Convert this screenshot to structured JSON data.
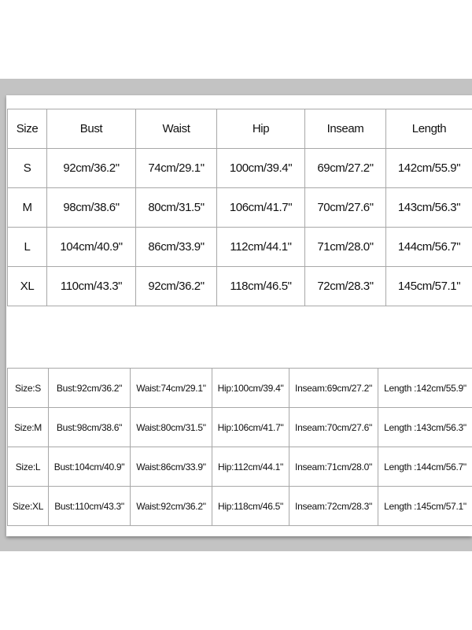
{
  "table1": {
    "headers": [
      "Size",
      "Bust",
      "Waist",
      "Hip",
      "Inseam",
      "Length"
    ],
    "rows": [
      [
        "S",
        "92cm/36.2\"",
        "74cm/29.1\"",
        "100cm/39.4\"",
        "69cm/27.2\"",
        "142cm/55.9\""
      ],
      [
        "M",
        "98cm/38.6\"",
        "80cm/31.5\"",
        "106cm/41.7\"",
        "70cm/27.6\"",
        "143cm/56.3\""
      ],
      [
        "L",
        "104cm/40.9\"",
        "86cm/33.9\"",
        "112cm/44.1\"",
        "71cm/28.0\"",
        "144cm/56.7\""
      ],
      [
        "XL",
        "110cm/43.3\"",
        "92cm/36.2\"",
        "118cm/46.5\"",
        "72cm/28.3\"",
        "145cm/57.1\""
      ]
    ]
  },
  "table2": {
    "rows": [
      [
        "Size:S",
        "Bust:92cm/36.2\"",
        "Waist:74cm/29.1\"",
        "Hip:100cm/39.4\"",
        "Inseam:69cm/27.2\"",
        "Length :142cm/55.9\""
      ],
      [
        "Size:M",
        "Bust:98cm/38.6\"",
        "Waist:80cm/31.5\"",
        "Hip:106cm/41.7\"",
        "Inseam:70cm/27.6\"",
        "Length :143cm/56.3\""
      ],
      [
        "Size:L",
        "Bust:104cm/40.9\"",
        "Waist:86cm/33.9\"",
        "Hip:112cm/44.1\"",
        "Inseam:71cm/28.0\"",
        "Length :144cm/56.7\""
      ],
      [
        "Size:XL",
        "Bust:110cm/43.3\"",
        "Waist:92cm/36.2\"",
        "Hip:118cm/46.5\"",
        "Inseam:72cm/28.3\"",
        "Length :145cm/57.1\""
      ]
    ]
  }
}
